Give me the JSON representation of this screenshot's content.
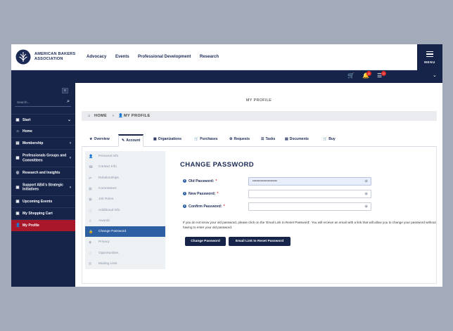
{
  "header": {
    "brand_line1": "AMERICAN BAKERS",
    "brand_line2": "ASSOCIATION",
    "nav": [
      "Advocacy",
      "Events",
      "Professional Development",
      "Research"
    ],
    "menu_label": "MENU",
    "cart_icon": "cart-icon",
    "bell_badge": "4",
    "list_badge": "0"
  },
  "sidebar": {
    "search_placeholder": "Search...",
    "items": [
      {
        "label": "Start",
        "icon": "play-icon",
        "chevron": "⌄"
      },
      {
        "label": "Home",
        "icon": "home-icon",
        "chevron": ""
      },
      {
        "label": "Membership",
        "icon": "id-card-icon",
        "chevron": "‹"
      },
      {
        "label": "Professionals Groups and Committees",
        "icon": "group-icon",
        "chevron": "‹"
      },
      {
        "label": "Research and Insights",
        "icon": "chart-icon",
        "chevron": ""
      },
      {
        "label": "Support ABA's Strategic Initiatives",
        "icon": "globe-icon",
        "chevron": "‹"
      },
      {
        "label": "Upcoming Events",
        "icon": "calendar-icon",
        "chevron": ""
      },
      {
        "label": "My Shopping Cart",
        "icon": "cart-icon",
        "chevron": ""
      },
      {
        "label": "My Profile",
        "icon": "user-icon",
        "chevron": ""
      }
    ]
  },
  "main": {
    "page_title": "MY PROFILE",
    "breadcrumb": {
      "home": "HOME",
      "current": "MY PROFILE"
    },
    "tabs": [
      {
        "label": "Overview",
        "icon": "★"
      },
      {
        "label": "Account",
        "icon": "✎"
      },
      {
        "label": "Organizations",
        "icon": "▦"
      },
      {
        "label": "Purchases",
        "icon": "🛒"
      },
      {
        "label": "Requests",
        "icon": "⚙"
      },
      {
        "label": "Tasks",
        "icon": "☰"
      },
      {
        "label": "Documents",
        "icon": "▤"
      },
      {
        "label": "Buy",
        "icon": "🛒"
      }
    ],
    "submenu": [
      {
        "label": "Personal Info",
        "icon": "👤"
      },
      {
        "label": "Contact Info",
        "icon": "☎"
      },
      {
        "label": "Relationships",
        "icon": "⇄"
      },
      {
        "label": "Committees",
        "icon": "▦"
      },
      {
        "label": "Job Roles",
        "icon": "▣"
      },
      {
        "label": "Additional Info",
        "icon": "ⓘ"
      },
      {
        "label": "Awards",
        "icon": "♕"
      },
      {
        "label": "Change Password",
        "icon": "🔒"
      },
      {
        "label": "Privacy",
        "icon": "◉"
      },
      {
        "label": "Opportunities",
        "icon": "☆"
      },
      {
        "label": "Mailing Lists",
        "icon": "≣"
      }
    ],
    "form": {
      "title": "CHANGE PASSWORD",
      "old_label": "Old Password:",
      "old_value": "••••••••••••••••••",
      "new_label": "New Password:",
      "new_value": "",
      "confirm_label": "Confirm Password:",
      "confirm_value": "",
      "required_mark": "*",
      "help_text": "If you do not know your old password, please click on the 'Email Link to Reset Password'. You will receive an email with a link that will allow you to change your password without having to enter your old password.",
      "change_button": "Change Password",
      "email_button": "Email Link to Reset Password"
    }
  }
}
